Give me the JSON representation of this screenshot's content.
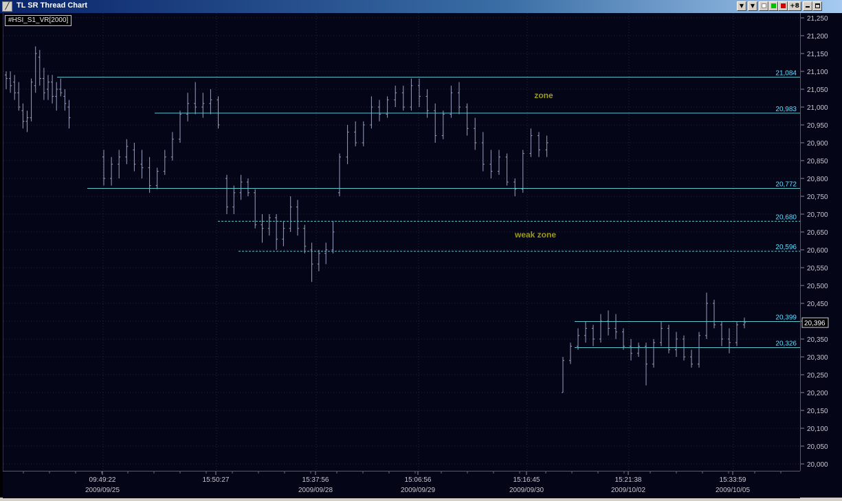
{
  "window": {
    "title": "TL SR Thread Chart",
    "buttons": [
      "▼",
      "▼",
      "",
      "",
      "",
      "+8",
      "",
      ""
    ]
  },
  "symbol_label": "#HSI_S1_VR[2000]",
  "price_axis": {
    "ticks": [
      "21,250",
      "21,200",
      "21,150",
      "21,100",
      "21,050",
      "21,000",
      "20,950",
      "20,900",
      "20,850",
      "20,800",
      "20,750",
      "20,700",
      "20,650",
      "20,600",
      "20,550",
      "20,500",
      "20,450",
      "20,400",
      "20,350",
      "20,300",
      "20,250",
      "20,200",
      "20,150",
      "20,100",
      "20,050",
      "20,000"
    ],
    "current_price": "20,396"
  },
  "time_axis": {
    "labels": [
      {
        "time": "09:49:22",
        "date": "2009/09/25"
      },
      {
        "time": "15:50:27",
        "date": ""
      },
      {
        "time": "15:37:56",
        "date": "2009/09/28"
      },
      {
        "time": "15:06:56",
        "date": "2009/09/29"
      },
      {
        "time": "15:16:45",
        "date": "2009/09/30"
      },
      {
        "time": "15:21:38",
        "date": "2009/10/02"
      },
      {
        "time": "15:33:59",
        "date": "2009/10/05"
      }
    ]
  },
  "sr_lines": [
    {
      "label": "21,084",
      "value": 21084,
      "style": "solid"
    },
    {
      "label": "20,983",
      "value": 20983,
      "style": "solid"
    },
    {
      "label": "20,772",
      "value": 20772,
      "style": "solid"
    },
    {
      "label": "20,680",
      "value": 20680,
      "style": "dashed"
    },
    {
      "label": "20,596",
      "value": 20596,
      "style": "dashed"
    },
    {
      "label": "20,399",
      "value": 20399,
      "style": "solid"
    },
    {
      "label": "20,326",
      "value": 20326,
      "style": "solid"
    }
  ],
  "annotations": [
    {
      "text": "zone"
    },
    {
      "text": "weak zone"
    }
  ],
  "colors": {
    "background": "#050518",
    "bars": "#9aa0c0",
    "sr_line": "#5ec8d0",
    "sr_label": "#5ee0ff",
    "annotation": "#9a9a20",
    "grid": "#25254a"
  },
  "chart_data": {
    "type": "bar",
    "y_range": [
      20000,
      21250
    ],
    "ohlc": [
      [
        21090,
        21100,
        21050,
        21080
      ],
      [
        21080,
        21100,
        21040,
        21060
      ],
      [
        21070,
        21090,
        21020,
        21040
      ],
      [
        21040,
        21070,
        20990,
        21000
      ],
      [
        20990,
        21010,
        20940,
        20960
      ],
      [
        20960,
        20990,
        20930,
        20970
      ],
      [
        20970,
        21080,
        20960,
        21070
      ],
      [
        21060,
        21170,
        21040,
        21150
      ],
      [
        21140,
        21160,
        21060,
        21080
      ],
      [
        21080,
        21110,
        21020,
        21040
      ],
      [
        21050,
        21090,
        21020,
        21070
      ],
      [
        21070,
        21090,
        21010,
        21030
      ],
      [
        21030,
        21070,
        20990,
        21050
      ],
      [
        21050,
        21080,
        21030,
        21040
      ],
      [
        21030,
        21050,
        20990,
        21010
      ],
      [
        21000,
        21020,
        20940,
        20970
      ],
      [
        20860,
        20880,
        20780,
        20800
      ],
      [
        20800,
        20860,
        20780,
        20840
      ],
      [
        20840,
        20880,
        20800,
        20860
      ],
      [
        20860,
        20910,
        20840,
        20890
      ],
      [
        20880,
        20900,
        20820,
        20840
      ],
      [
        20840,
        20880,
        20800,
        20830
      ],
      [
        20830,
        20860,
        20760,
        20780
      ],
      [
        20780,
        20830,
        20770,
        20820
      ],
      [
        20820,
        20880,
        20810,
        20860
      ],
      [
        20860,
        20930,
        20850,
        20910
      ],
      [
        20910,
        20990,
        20900,
        20980
      ],
      [
        20980,
        21040,
        20960,
        21010
      ],
      [
        21010,
        21070,
        20980,
        21000
      ],
      [
        21000,
        21040,
        20970,
        21010
      ],
      [
        21010,
        21050,
        20980,
        21020
      ],
      [
        21020,
        21030,
        20940,
        20950
      ],
      [
        20800,
        20810,
        20700,
        20720
      ],
      [
        20720,
        20780,
        20700,
        20760
      ],
      [
        20760,
        20810,
        20740,
        20790
      ],
      [
        20790,
        20800,
        20750,
        20760
      ],
      [
        20760,
        20770,
        20660,
        20670
      ],
      [
        20670,
        20700,
        20620,
        20660
      ],
      [
        20660,
        20700,
        20640,
        20690
      ],
      [
        20690,
        20700,
        20600,
        20630
      ],
      [
        20630,
        20680,
        20610,
        20660
      ],
      [
        20660,
        20750,
        20650,
        20720
      ],
      [
        20720,
        20740,
        20640,
        20660
      ],
      [
        20660,
        20670,
        20590,
        20610
      ],
      [
        20600,
        20620,
        20510,
        20560
      ],
      [
        20560,
        20600,
        20540,
        20590
      ],
      [
        20590,
        20620,
        20560,
        20600
      ],
      [
        20600,
        20680,
        20590,
        20650
      ],
      [
        20760,
        20870,
        20750,
        20860
      ],
      [
        20860,
        20950,
        20840,
        20930
      ],
      [
        20930,
        20960,
        20890,
        20900
      ],
      [
        20900,
        20960,
        20890,
        20950
      ],
      [
        20950,
        21030,
        20940,
        21000
      ],
      [
        21000,
        21020,
        20960,
        20980
      ],
      [
        20980,
        21030,
        20970,
        21020
      ],
      [
        21020,
        21060,
        21000,
        21040
      ],
      [
        21040,
        21060,
        20990,
        21000
      ],
      [
        21000,
        21080,
        20990,
        21060
      ],
      [
        21060,
        21080,
        21000,
        21030
      ],
      [
        21030,
        21050,
        20970,
        20990
      ],
      [
        20990,
        21010,
        20900,
        20920
      ],
      [
        20920,
        20990,
        20910,
        20980
      ],
      [
        20980,
        21060,
        20970,
        21040
      ],
      [
        21040,
        21070,
        20980,
        21000
      ],
      [
        21000,
        21010,
        20920,
        20940
      ],
      [
        20940,
        20970,
        20880,
        20900
      ],
      [
        20900,
        20930,
        20820,
        20840
      ],
      [
        20840,
        20880,
        20800,
        20820
      ],
      [
        20820,
        20880,
        20810,
        20860
      ],
      [
        20860,
        20870,
        20780,
        20790
      ],
      [
        20790,
        20800,
        20750,
        20770
      ],
      [
        20770,
        20880,
        20760,
        20870
      ],
      [
        20870,
        20940,
        20860,
        20920
      ],
      [
        20920,
        20930,
        20860,
        20880
      ],
      [
        20880,
        20920,
        20860,
        20900
      ],
      [
        20200,
        20300,
        20200,
        20290
      ],
      [
        20290,
        20340,
        20280,
        20330
      ],
      [
        20330,
        20380,
        20320,
        20360
      ],
      [
        20360,
        20400,
        20340,
        20380
      ],
      [
        20380,
        20390,
        20330,
        20350
      ],
      [
        20350,
        20420,
        20340,
        20400
      ],
      [
        20400,
        20430,
        20360,
        20380
      ],
      [
        20380,
        20420,
        20350,
        20370
      ],
      [
        20370,
        20380,
        20320,
        20330
      ],
      [
        20330,
        20350,
        20290,
        20310
      ],
      [
        20310,
        20340,
        20300,
        20330
      ],
      [
        20330,
        20340,
        20220,
        20280
      ],
      [
        20280,
        20350,
        20270,
        20340
      ],
      [
        20340,
        20400,
        20330,
        20380
      ],
      [
        20380,
        20390,
        20310,
        20320
      ],
      [
        20320,
        20370,
        20300,
        20350
      ],
      [
        20350,
        20360,
        20290,
        20300
      ],
      [
        20300,
        20320,
        20270,
        20280
      ],
      [
        20280,
        20370,
        20270,
        20360
      ],
      [
        20360,
        20480,
        20350,
        20450
      ],
      [
        20450,
        20460,
        20380,
        20390
      ],
      [
        20390,
        20400,
        20330,
        20350
      ],
      [
        20350,
        20380,
        20310,
        20340
      ],
      [
        20340,
        20400,
        20330,
        20390
      ],
      [
        20390,
        20410,
        20380,
        20396
      ]
    ]
  }
}
